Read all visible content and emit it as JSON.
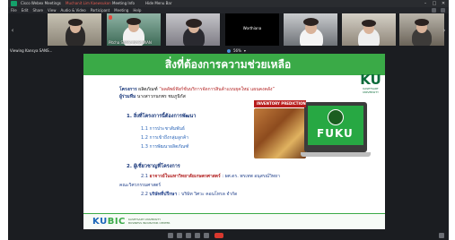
{
  "window": {
    "title": "Cisco Webex Meetings",
    "active_speaker": "Muchanit Lim Kaewsukon",
    "meeting_info": "Meeting Info",
    "hide_menu": "Hide Menu Bar"
  },
  "menu": [
    "File",
    "Edit",
    "Share",
    "View",
    "Audio & Video",
    "Participant",
    "Meeting",
    "Help"
  ],
  "participants": [
    {
      "name": ""
    },
    {
      "name": "Pitcha SANSANASUWAN"
    },
    {
      "name": ""
    },
    {
      "name": "Worthiana"
    },
    {
      "name": ""
    },
    {
      "name": ""
    },
    {
      "name": ""
    }
  ],
  "status": {
    "viewing": "Viewing Kansya SANS...",
    "zoom": "56%"
  },
  "slide": {
    "title": "สิ่งที่ต้องการความช่วยเหลือ",
    "logo": "KU",
    "logo_sub": "KASETSART UNIVERSITY",
    "project_label": "โครงการ",
    "project_prefix": "ผลิตภัณฑ์",
    "project_name": "“ผลลัพธ์ฟังก์ชั่นบริการจัดการสินค้าแบบยุคใหม่ แผนคงคลัง”",
    "student_label": "ผู้ร่วมทีม",
    "student_names": "นางสาวกนกพร ชมภูนิกัส",
    "section1": "1. สิ่งที่โครงการนี้ต้องการพัฒนา",
    "items1": [
      "1.1 การประชาสัมพันธ์",
      "1.2 การเข้าถึงกลุ่มลูกค้า",
      "1.3 การพัฒนาผลิตภัณฑ์"
    ],
    "section2": "2. ผู้เชี่ยวชาญที่โครงการ",
    "advisor1_prefix": "2.1",
    "advisor1_bold": "อาจารย์ในมหาวิทยาลัยเกษตรศาสตร์",
    "advisor1_name": ": ผศ.ดร. พรเทพ อนุสรณ์วิทยา",
    "advisor1_dept": "คณะวิศวกรรมศาสตร์",
    "advisor2_prefix": "2.2",
    "advisor2_bold": "บริษัทที่ปรึกษา",
    "advisor2_name": ": บริษัท วิศวะ คอนโทรล จำกัด",
    "promo_banner": "INVENTORY PREDICTION",
    "promo_brand": "FUKU",
    "footer_logo_ku": "KU",
    "footer_logo_bic": "BIC",
    "footer_sub1": "KASETSART UNIVERSITY",
    "footer_sub2": "BUSINESS INCUBATOR CENTER"
  },
  "colors": {
    "header_green": "#3aaa47",
    "title_blue": "#17367a",
    "highlight_red": "#b32222",
    "link_blue": "#2c66b8",
    "end_red": "#d9382e"
  }
}
